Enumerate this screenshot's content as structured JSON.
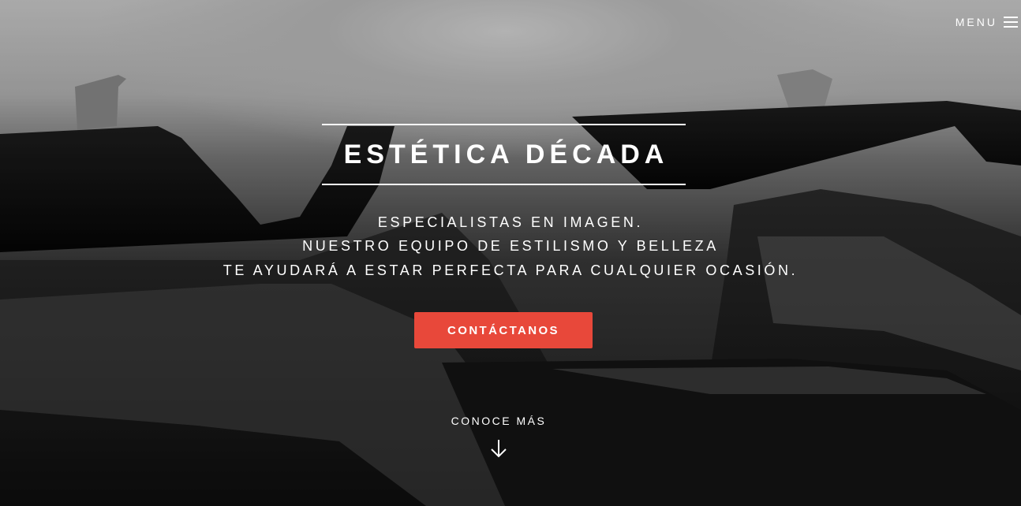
{
  "header": {
    "menu_label": "MENU"
  },
  "hero": {
    "title": "ESTÉTICA DÉCADA",
    "tagline": [
      "ESPECIALISTAS EN IMAGEN.",
      "NUESTRO EQUIPO DE ESTILISMO Y BELLEZA",
      "TE AYUDARÁ A ESTAR PERFECTA PARA CUALQUIER OCASIÓN."
    ],
    "cta_label": "CONTÁCTANOS",
    "learn_more_label": "CONOCE MÁS"
  },
  "icons": {
    "menu": "hamburger-icon",
    "scroll": "arrow-down-icon"
  },
  "colors": {
    "accent": "#e8483a",
    "text": "#ffffff"
  }
}
